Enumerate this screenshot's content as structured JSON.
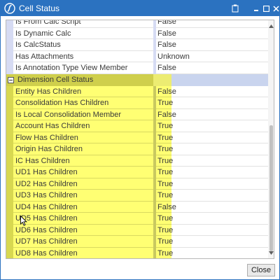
{
  "window": {
    "title": "Cell Status",
    "icons": [
      "onestream-logo-icon",
      "clipboard-icon",
      "maximize-icon",
      "close-icon"
    ]
  },
  "grid": {
    "rows_above": [
      {
        "name": "Is From Calc Script",
        "value": "False"
      },
      {
        "name": "Is Dynamic Calc",
        "value": "False"
      },
      {
        "name": "Is CalcStatus",
        "value": "False"
      },
      {
        "name": "Has Attachments",
        "value": "Unknown"
      },
      {
        "name": "Is Annotation Type View Member",
        "value": "False"
      }
    ],
    "group": {
      "label": "Dimension Cell Status",
      "expanded": true
    },
    "group_rows": [
      {
        "name": "Entity Has Children",
        "value": "False"
      },
      {
        "name": "Consolidation Has Children",
        "value": "True"
      },
      {
        "name": "Is Local Consolidation Member",
        "value": "False"
      },
      {
        "name": "Account Has Children",
        "value": "True"
      },
      {
        "name": "Flow Has Children",
        "value": "True"
      },
      {
        "name": "Origin Has Children",
        "value": "True"
      },
      {
        "name": "IC Has Children",
        "value": "True"
      },
      {
        "name": "UD1 Has Children",
        "value": "True"
      },
      {
        "name": "UD2 Has Children",
        "value": "True"
      },
      {
        "name": "UD3 Has Children",
        "value": "True"
      },
      {
        "name": "UD4 Has Children",
        "value": "False"
      },
      {
        "name": "UD5 Has Children",
        "value": "True"
      },
      {
        "name": "UD6 Has Children",
        "value": "True"
      },
      {
        "name": "UD7 Has Children",
        "value": "True"
      },
      {
        "name": "UD8 Has Children",
        "value": "True"
      }
    ]
  },
  "footer": {
    "close_label": "Close"
  },
  "colors": {
    "titlebar": "#2b72c0",
    "highlight": "#ffff73",
    "group_header": "#c9d4ee"
  }
}
